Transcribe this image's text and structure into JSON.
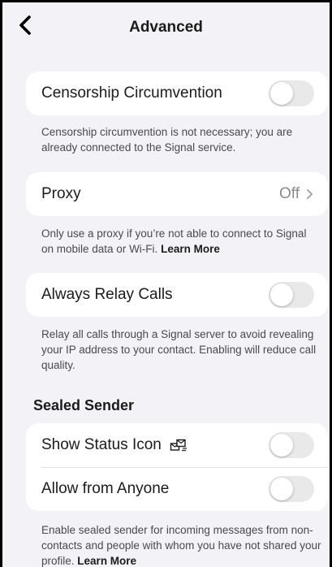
{
  "nav": {
    "title": "Advanced",
    "back_icon": "chevron-left-icon"
  },
  "censorship": {
    "label": "Censorship Circumvention",
    "enabled": false,
    "footer": "Censorship circumvention is not necessary; you are already connected to the Signal service."
  },
  "proxy": {
    "label": "Proxy",
    "value": "Off",
    "chevron_icon": "chevron-right-icon",
    "footer": "Only use a proxy if you’re not able to connect to Signal on mobile data or Wi-Fi.",
    "learn_more": "Learn More"
  },
  "relay_calls": {
    "label": "Always Relay Calls",
    "enabled": false,
    "footer": "Relay all calls through a Signal server to avoid revealing your IP address to your contact. Enabling will reduce call quality."
  },
  "sealed_sender": {
    "header": "Sealed Sender",
    "show_status_icon": {
      "label": "Show Status Icon",
      "icon": "sealed-sender-icon",
      "enabled": false
    },
    "allow_from_anyone": {
      "label": "Allow from Anyone",
      "enabled": false
    },
    "footer": "Enable sealed sender for incoming messages from non-contacts and people with whom you have not shared your profile.",
    "learn_more": "Learn More"
  },
  "colors": {
    "background": "#f2f2f7",
    "card": "#ffffff",
    "toggle_off": "#e9e9ea",
    "secondary_text": "#8a8a8e"
  }
}
